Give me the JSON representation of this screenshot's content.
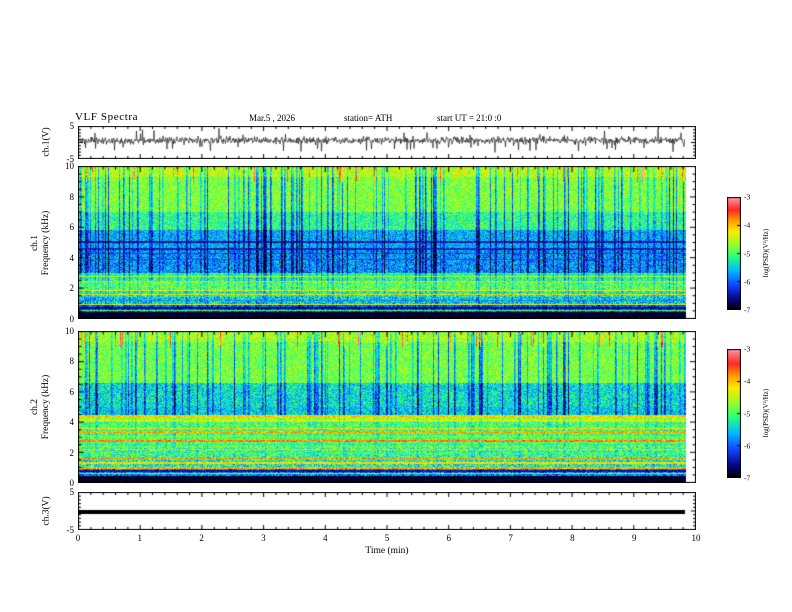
{
  "header": {
    "title": "VLF Spectra",
    "date": "Mar.5 , 2026",
    "station": "station= ATH",
    "start_ut": "start UT =  21:0 :0"
  },
  "axes": {
    "x": {
      "label": "Time  (min)",
      "range": [
        0,
        10
      ],
      "ticks": [
        0,
        1,
        2,
        3,
        4,
        5,
        6,
        7,
        8,
        9,
        10
      ]
    },
    "spec_y": {
      "label": "Frequency (kHz)",
      "range": [
        0,
        10
      ],
      "ticks": [
        0,
        2,
        4,
        6,
        8,
        10
      ]
    },
    "volt_y": {
      "range": [
        -5,
        5
      ],
      "ticks": [
        5,
        -5
      ]
    }
  },
  "panels": {
    "ch1_wave": {
      "label": "ch.1(V)"
    },
    "ch1_spec": {
      "label_line1": "ch.1",
      "label_line2": "Frequency (kHz)"
    },
    "ch2_spec": {
      "label_line1": "ch.2",
      "label_line2": "Frequency (kHz)"
    },
    "ch3_wave": {
      "label": "ch.3(V)"
    }
  },
  "colorbar": {
    "label": "log(PSD)(V²/Hz)",
    "range": [
      -7,
      -3
    ],
    "ticks": [
      -3,
      -4,
      -5,
      -6,
      -7
    ],
    "stops": [
      [
        0,
        0,
        0,
        0
      ],
      [
        0.1,
        8,
        8,
        140
      ],
      [
        0.22,
        20,
        70,
        255
      ],
      [
        0.35,
        0,
        190,
        255
      ],
      [
        0.47,
        40,
        255,
        130
      ],
      [
        0.58,
        150,
        255,
        40
      ],
      [
        0.7,
        255,
        235,
        0
      ],
      [
        0.8,
        255,
        150,
        0
      ],
      [
        0.89,
        255,
        40,
        40
      ],
      [
        1,
        255,
        150,
        160
      ]
    ]
  },
  "chart_data": [
    {
      "type": "line",
      "name": "ch1_voltage_timeseries",
      "ylabel": "ch.1(V)",
      "xlabel": "Time (min)",
      "xlim": [
        0,
        10
      ],
      "ylim": [
        -5,
        5
      ],
      "description": "Broadband noisy VLF waveform centered near +0.5 V with frequent impulsive sferic spikes reaching about -4 to +4 V; record extends to about 9.85 min.",
      "gen": {
        "seed": 11,
        "baseline": 0.5,
        "noise": 0.55,
        "spike_prob": 0.055,
        "spike_min": 1.2,
        "spike_max": 3.8,
        "down_bias": 0.68,
        "x_frac": 0.985
      }
    },
    {
      "type": "heatmap",
      "name": "ch1_spectrogram",
      "ylabel": "ch.1 Frequency (kHz)",
      "xlabel": "Time (min)",
      "xlim": [
        0,
        10
      ],
      "ylim": [
        0,
        10
      ],
      "zlabel": "log(PSD)(V²/Hz)",
      "zlim": [
        -7,
        -3
      ],
      "description": "Green background (~-5 log PSD) above 6 kHz with dense vertical blue sferic striations; dark blue band 3-5.8 kHz (~-6.3); narrow very dark lines near 4.6 and 5 kHz; mixed green/orange horizontal interference lines 0.5-2.8 kHz; solid black band below 0.45 kHz; occasional yellow-orange bursts at the 9-10 kHz top edge.",
      "gen": {
        "seed": 42,
        "x_frac": 0.985,
        "streak_prob": 0.22,
        "streak_min": 0.12,
        "streak_max": 0.38,
        "tip_prob": 0.06,
        "bands": [
          {
            "f0": 9.3,
            "f1": 10.01,
            "t": 0.62,
            "n": 0.12,
            "sv": 0.75
          },
          {
            "f0": 7.0,
            "f1": 9.3,
            "t": 0.56,
            "n": 0.1,
            "sv": 0.95
          },
          {
            "f0": 5.8,
            "f1": 7.0,
            "t": 0.47,
            "n": 0.11,
            "sv": 0.95
          },
          {
            "f0": 4.6,
            "f1": 5.8,
            "t": 0.33,
            "n": 0.11,
            "sv": 0.85
          },
          {
            "f0": 3.0,
            "f1": 4.6,
            "t": 0.3,
            "n": 0.13,
            "sv": 0.85
          },
          {
            "f0": 2.5,
            "f1": 3.0,
            "t": 0.46,
            "n": 0.11,
            "sv": 0.55
          },
          {
            "f0": 1.9,
            "f1": 2.5,
            "t": 0.52,
            "n": 0.13,
            "sv": 0.4
          },
          {
            "f0": 1.4,
            "f1": 1.9,
            "t": 0.44,
            "n": 0.15,
            "sv": 0.3
          },
          {
            "f0": 0.9,
            "f1": 1.4,
            "t": 0.38,
            "n": 0.17,
            "sv": 0.2
          },
          {
            "f0": 0.45,
            "f1": 0.9,
            "t": 0.22,
            "n": 0.14,
            "sv": 0.1
          },
          {
            "f0": 0.0,
            "f1": 0.45,
            "t": 0.03,
            "n": 0.03,
            "sv": 0.0
          }
        ],
        "hlines": [
          {
            "f": 5.05,
            "t": 0.13,
            "w": 2
          },
          {
            "f": 4.6,
            "t": 0.16,
            "w": 2
          },
          {
            "f": 4.25,
            "t": 0.2,
            "w": 1
          },
          {
            "f": 3.9,
            "t": 0.22,
            "w": 1
          },
          {
            "f": 2.75,
            "t": 0.6,
            "w": 1
          },
          {
            "f": 2.45,
            "t": 0.74,
            "w": 1
          },
          {
            "f": 2.15,
            "t": 0.5,
            "w": 1
          },
          {
            "f": 1.85,
            "t": 0.66,
            "w": 1
          },
          {
            "f": 1.55,
            "t": 0.72,
            "w": 1
          },
          {
            "f": 1.2,
            "t": 0.3,
            "w": 1
          },
          {
            "f": 0.95,
            "t": 0.66,
            "w": 1
          },
          {
            "f": 0.75,
            "t": 0.1,
            "w": 2
          },
          {
            "f": 0.55,
            "t": 0.5,
            "w": 1
          }
        ]
      }
    },
    {
      "type": "heatmap",
      "name": "ch2_spectrogram",
      "ylabel": "ch.2 Frequency (kHz)",
      "xlabel": "Time (min)",
      "xlim": [
        0,
        10
      ],
      "ylim": [
        0,
        10
      ],
      "zlabel": "log(PSD)(V²/Hz)",
      "zlim": [
        -7,
        -3
      ],
      "description": "Green background above 6.5 kHz with vertical blue sferic striations; blotchy blue band 4.5-6.5 kHz; strong yellow-orange horizontal interference lines near 4.3, 3.3, 2.8, 2.2, 1.3 and 1.0 kHz over a green/cyan floor; solid black band below 0.45 kHz.",
      "gen": {
        "seed": 77,
        "x_frac": 0.985,
        "streak_prob": 0.2,
        "streak_min": 0.12,
        "streak_max": 0.36,
        "tip_prob": 0.06,
        "bands": [
          {
            "f0": 9.3,
            "f1": 10.01,
            "t": 0.6,
            "n": 0.12,
            "sv": 0.7
          },
          {
            "f0": 6.6,
            "f1": 9.3,
            "t": 0.55,
            "n": 0.1,
            "sv": 0.95
          },
          {
            "f0": 5.0,
            "f1": 6.6,
            "t": 0.4,
            "n": 0.13,
            "sv": 0.9
          },
          {
            "f0": 4.5,
            "f1": 5.0,
            "t": 0.37,
            "n": 0.12,
            "sv": 0.8
          },
          {
            "f0": 4.0,
            "f1": 4.5,
            "t": 0.6,
            "n": 0.12,
            "sv": 0.4
          },
          {
            "f0": 3.0,
            "f1": 4.0,
            "t": 0.5,
            "n": 0.12,
            "sv": 0.3
          },
          {
            "f0": 2.3,
            "f1": 3.0,
            "t": 0.52,
            "n": 0.13,
            "sv": 0.25
          },
          {
            "f0": 1.5,
            "f1": 2.3,
            "t": 0.48,
            "n": 0.15,
            "sv": 0.2
          },
          {
            "f0": 0.9,
            "f1": 1.5,
            "t": 0.44,
            "n": 0.17,
            "sv": 0.15
          },
          {
            "f0": 0.45,
            "f1": 0.9,
            "t": 0.28,
            "n": 0.15,
            "sv": 0.1
          },
          {
            "f0": 0.0,
            "f1": 0.45,
            "t": 0.03,
            "n": 0.03,
            "sv": 0.0
          }
        ],
        "hlines": [
          {
            "f": 4.35,
            "t": 0.74,
            "w": 2
          },
          {
            "f": 4.1,
            "t": 0.66,
            "w": 1
          },
          {
            "f": 3.6,
            "t": 0.7,
            "w": 1
          },
          {
            "f": 3.35,
            "t": 0.78,
            "w": 2
          },
          {
            "f": 3.05,
            "t": 0.55,
            "w": 1
          },
          {
            "f": 2.8,
            "t": 0.82,
            "w": 2
          },
          {
            "f": 2.5,
            "t": 0.45,
            "w": 1
          },
          {
            "f": 2.2,
            "t": 0.74,
            "w": 1
          },
          {
            "f": 1.9,
            "t": 0.5,
            "w": 1
          },
          {
            "f": 1.6,
            "t": 0.8,
            "w": 1
          },
          {
            "f": 1.3,
            "t": 0.72,
            "w": 2
          },
          {
            "f": 1.0,
            "t": 0.78,
            "w": 2
          },
          {
            "f": 0.8,
            "t": 0.12,
            "w": 2
          },
          {
            "f": 0.6,
            "t": 0.55,
            "w": 1
          }
        ]
      }
    },
    {
      "type": "line",
      "name": "ch3_voltage_timeseries",
      "ylabel": "ch.3(V)",
      "xlabel": "Time (min)",
      "xlim": [
        0,
        10
      ],
      "ylim": [
        -5,
        5
      ],
      "description": "Flat thick black trace at approximately -0.3 V for the whole record (constant / no signal channel).",
      "gen": {
        "flat_value": -0.3,
        "line_width": 4,
        "x_frac": 0.985
      }
    }
  ]
}
